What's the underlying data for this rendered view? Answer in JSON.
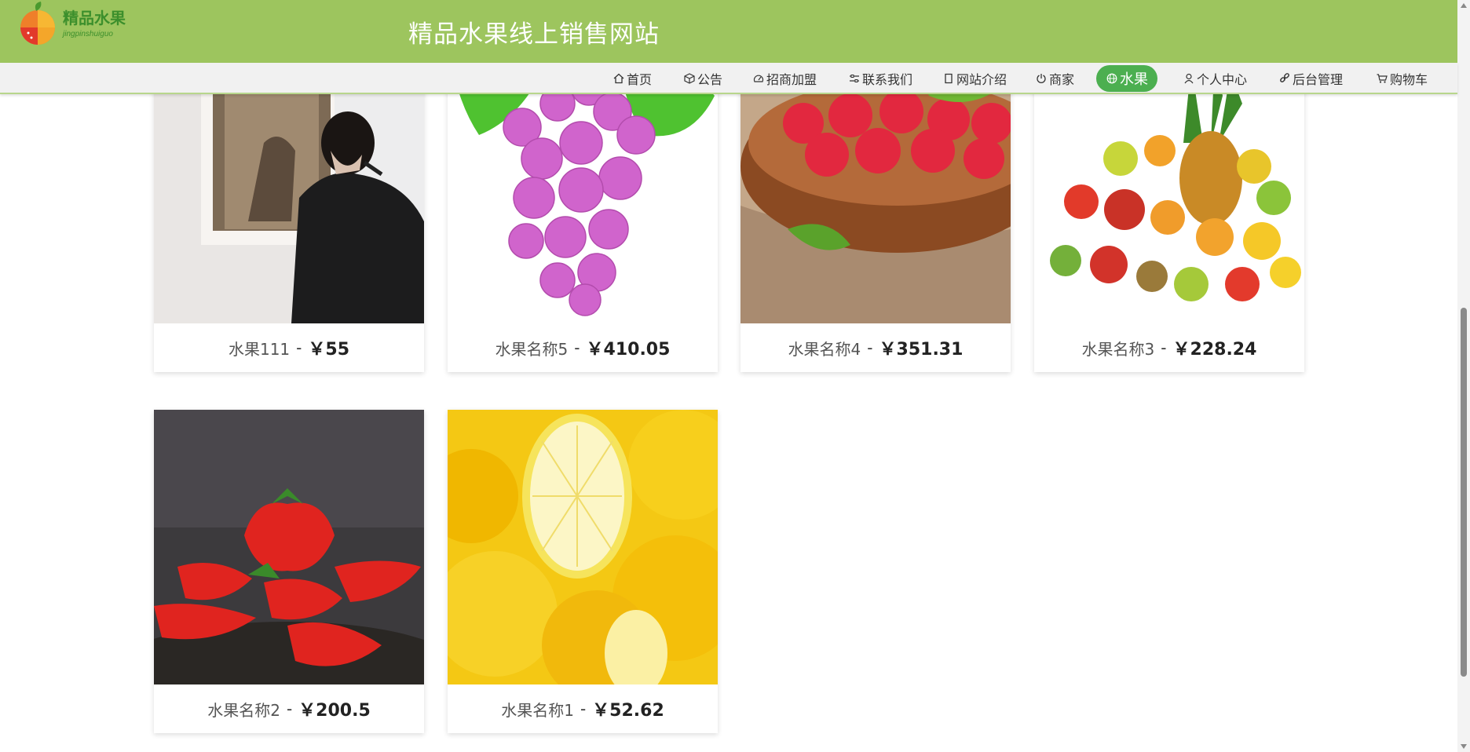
{
  "header": {
    "site_title": "精品水果线上销售网站",
    "logo_text": "精品水果",
    "logo_pinyin": "jingpinshuiguo"
  },
  "nav": [
    {
      "label": "首页",
      "icon": "home-icon"
    },
    {
      "label": "公告",
      "icon": "box-icon"
    },
    {
      "label": "招商加盟",
      "icon": "gauge-icon"
    },
    {
      "label": "联系我们",
      "icon": "sliders-icon"
    },
    {
      "label": "网站介绍",
      "icon": "notebook-icon"
    },
    {
      "label": "商家",
      "icon": "power-icon"
    },
    {
      "label": "水果",
      "icon": "globe-icon",
      "active": true
    },
    {
      "label": "个人中心",
      "icon": "user-icon"
    },
    {
      "label": "后台管理",
      "icon": "link-icon"
    },
    {
      "label": "购物车",
      "icon": "cart-icon"
    }
  ],
  "products": [
    {
      "name": "水果111",
      "price": "￥55",
      "image": "person-photo"
    },
    {
      "name": "水果名称5",
      "price": "￥410.05",
      "image": "grapes"
    },
    {
      "name": "水果名称4",
      "price": "￥351.31",
      "image": "raspberries"
    },
    {
      "name": "水果名称3",
      "price": "￥228.24",
      "image": "mixed-fruit"
    },
    {
      "name": "水果名称2",
      "price": "￥200.5",
      "image": "strawberries"
    },
    {
      "name": "水果名称1",
      "price": "￥52.62",
      "image": "lemons"
    }
  ],
  "colors": {
    "header_bg": "#9dc55e",
    "nav_bg": "#f1f1f1",
    "nav_active": "#4caf50"
  }
}
